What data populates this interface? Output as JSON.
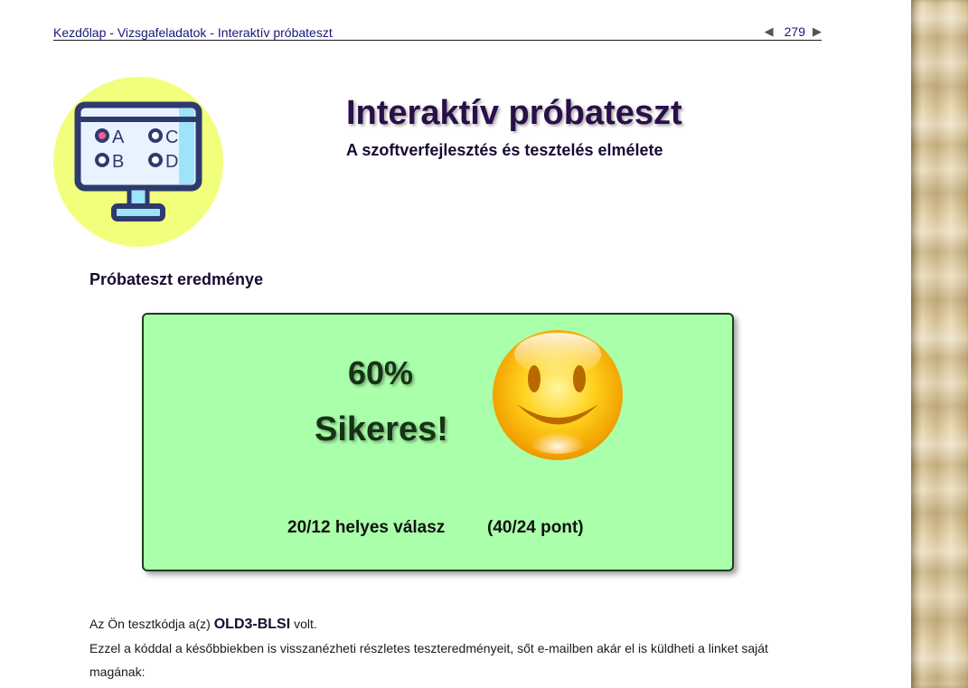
{
  "breadcrumb": {
    "home": "Kezdőlap",
    "separator": "-",
    "section": "Vizsgafeladatok",
    "current": "Interaktív próbateszt"
  },
  "pager": {
    "prev_icon": "triangle-left-icon",
    "page_number": "279",
    "next_icon": "triangle-right-icon"
  },
  "header": {
    "title": "Interaktív próbateszt",
    "subtitle": "A szoftverfejlesztés és tesztelés elmélete"
  },
  "logo": {
    "icon": "quiz-monitor-icon",
    "options": [
      "A",
      "C",
      "B",
      "D"
    ]
  },
  "result": {
    "heading": "Próbateszt eredménye",
    "percent": "60%",
    "status": "Sikeres!",
    "correct_answers": "20/12 helyes válasz",
    "points": "(40/24 pont)",
    "icon": "smiley-face-icon",
    "background_color": "#aaffaa"
  },
  "info": {
    "line1_prefix": "Az Ön tesztkódja a(z)",
    "test_code": "OLD3-BLSI",
    "line1_suffix": "volt.",
    "line2": "Ezzel a kóddal a későbbiekben is visszanézheti részletes teszteredményeit, sőt e-mailben akár el is küldheti a linket saját magának:"
  }
}
